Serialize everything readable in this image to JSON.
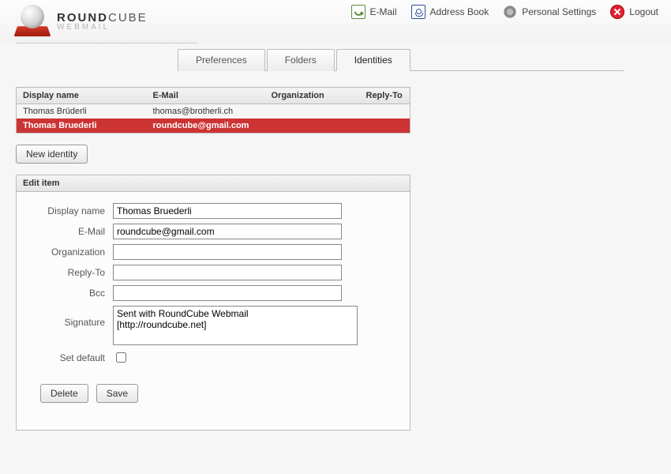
{
  "brand": {
    "line1a": "ROUND",
    "line1b": "CUBE",
    "line2": "WEBMAIL"
  },
  "topnav": {
    "email": "E-Mail",
    "addressbook": "Address Book",
    "settings": "Personal Settings",
    "logout": "Logout"
  },
  "tabs": {
    "preferences": "Preferences",
    "folders": "Folders",
    "identities": "Identities"
  },
  "table": {
    "headers": {
      "name": "Display name",
      "email": "E-Mail",
      "org": "Organization",
      "reply": "Reply-To"
    },
    "rows": [
      {
        "name": "Thomas Brüderli",
        "email": "thomas@brotherli.ch",
        "org": "",
        "reply": ""
      },
      {
        "name": "Thomas Bruederli",
        "email": "roundcube@gmail.com",
        "org": "",
        "reply": ""
      }
    ],
    "selected_index": 1
  },
  "buttons": {
    "new_identity": "New identity",
    "delete": "Delete",
    "save": "Save"
  },
  "panel": {
    "title": "Edit item",
    "labels": {
      "display_name": "Display name",
      "email": "E-Mail",
      "organization": "Organization",
      "reply_to": "Reply-To",
      "bcc": "Bcc",
      "signature": "Signature",
      "set_default": "Set default"
    },
    "values": {
      "display_name": "Thomas Bruederli",
      "email": "roundcube@gmail.com",
      "organization": "",
      "reply_to": "",
      "bcc": "",
      "signature": "Sent with RoundCube Webmail\n[http://roundcube.net]",
      "set_default": false
    }
  }
}
